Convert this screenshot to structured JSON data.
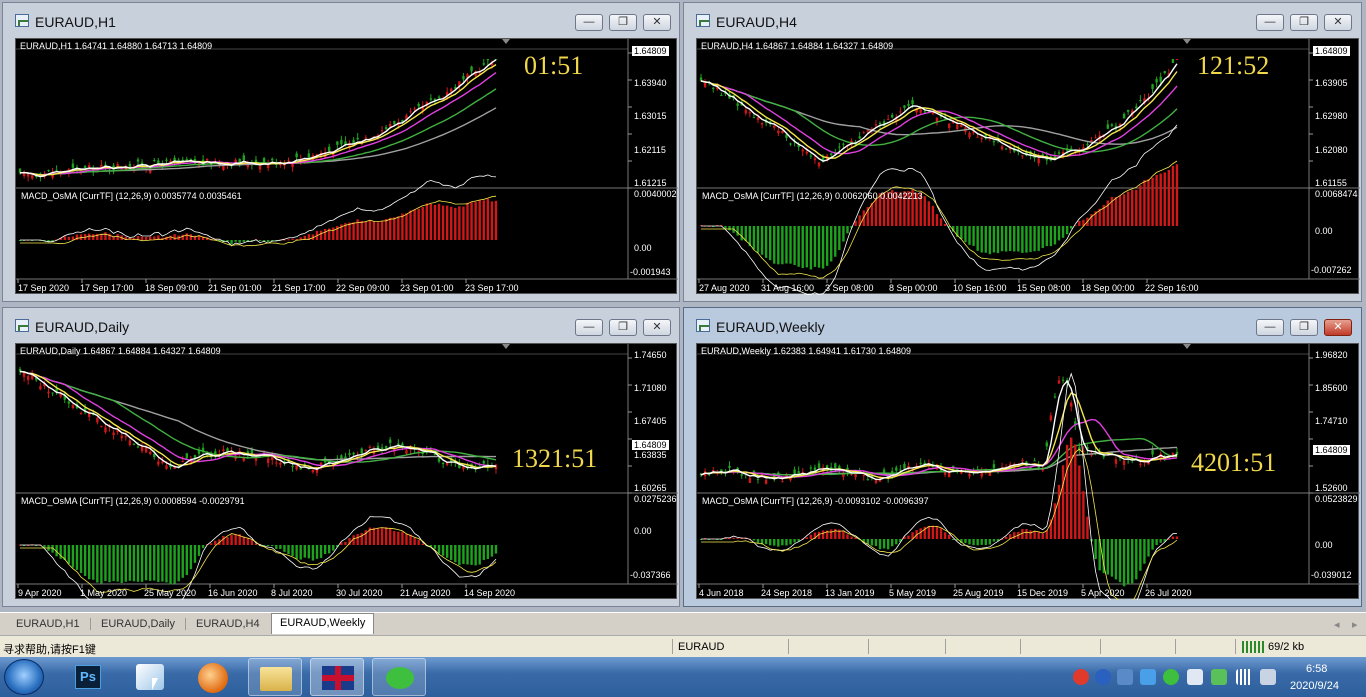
{
  "windows": [
    {
      "id": "h1",
      "title": "EURAUD,H1",
      "info": "EURAUD,H1  1.64741 1.64880 1.64713 1.64809",
      "macd_label": "MACD_OsMA [CurrTF] (12,26,9) 0.0035774 0.0035461",
      "timer": "01:51",
      "prices": [
        "1.64809",
        "1.63940",
        "1.63015",
        "1.62115",
        "1.61215"
      ],
      "badge": "1.64809",
      "macd_scale": [
        "0.0040002",
        "0.00",
        "-0.001943"
      ],
      "dates": [
        "17 Sep 2020",
        "17 Sep 17:00",
        "18 Sep 09:00",
        "21 Sep 01:00",
        "21 Sep 17:00",
        "22 Sep 09:00",
        "23 Sep 01:00",
        "23 Sep 17:00"
      ]
    },
    {
      "id": "h4",
      "title": "EURAUD,H4",
      "info": "EURAUD,H4  1.64867 1.64884 1.64327 1.64809",
      "macd_label": "MACD_OsMA [CurrTF] (12,26,9) 0.0062060 0.0042213",
      "timer": "121:52",
      "prices": [
        "1.64809",
        "1.63905",
        "1.62980",
        "1.62080",
        "1.61155"
      ],
      "badge": "1.64809",
      "macd_scale": [
        "0.0068474",
        "0.00",
        "-0.007262"
      ],
      "dates": [
        "27 Aug 2020",
        "31 Aug 16:00",
        "3 Sep 08:00",
        "8 Sep 00:00",
        "10 Sep 16:00",
        "15 Sep 08:00",
        "18 Sep 00:00",
        "22 Sep 16:00"
      ]
    },
    {
      "id": "d1",
      "title": "EURAUD,Daily",
      "info": "EURAUD,Daily  1.64867 1.64884 1.64327 1.64809",
      "macd_label": "MACD_OsMA [CurrTF] (12,26,9) 0.0008594 -0.0029791",
      "timer": "1321:51",
      "prices": [
        "1.74650",
        "1.71080",
        "1.67405",
        "1.63835",
        "1.60265"
      ],
      "badge": "1.64809",
      "macd_scale": [
        "0.0275236",
        "0.00",
        "-0.037366"
      ],
      "dates": [
        "9 Apr 2020",
        "1 May 2020",
        "25 May 2020",
        "16 Jun 2020",
        "8 Jul 2020",
        "30 Jul 2020",
        "21 Aug 2020",
        "14 Sep 2020"
      ]
    },
    {
      "id": "w1",
      "title": "EURAUD,Weekly",
      "info": "EURAUD,Weekly  1.62383 1.64941 1.61730 1.64809",
      "macd_label": "MACD_OsMA [CurrTF] (12,26,9) -0.0093102 -0.0096397",
      "timer": "4201:51",
      "prices": [
        "1.96820",
        "1.85600",
        "1.74710",
        "1.64809",
        "1.52600"
      ],
      "badge": "1.64809",
      "macd_scale": [
        "0.0523829",
        "0.00",
        "-0.039012"
      ],
      "dates": [
        "4 Jun 2018",
        "24 Sep 2018",
        "13 Jan 2019",
        "5 May 2019",
        "25 Aug 2019",
        "15 Dec 2019",
        "5 Apr 2020",
        "26 Jul 2020"
      ]
    }
  ],
  "tabs": [
    "EURAUD,H1",
    "EURAUD,Daily",
    "EURAUD,H4",
    "EURAUD,Weekly"
  ],
  "status": {
    "help": "寻求帮助,请按F1键",
    "symbol": "EURAUD",
    "traffic": "69/2 kb"
  },
  "taskbar": {
    "time": "6:58",
    "date": "2020/9/24"
  },
  "colors": {
    "bull": "#1fa31f",
    "bear": "#d01818",
    "ma_white": "#ffffff",
    "ma_yellow": "#f5e84a",
    "ma_magenta": "#e040e0",
    "ma_green": "#40b040",
    "ma_gray": "#a0a0a0",
    "timer": "#f0d84a"
  }
}
